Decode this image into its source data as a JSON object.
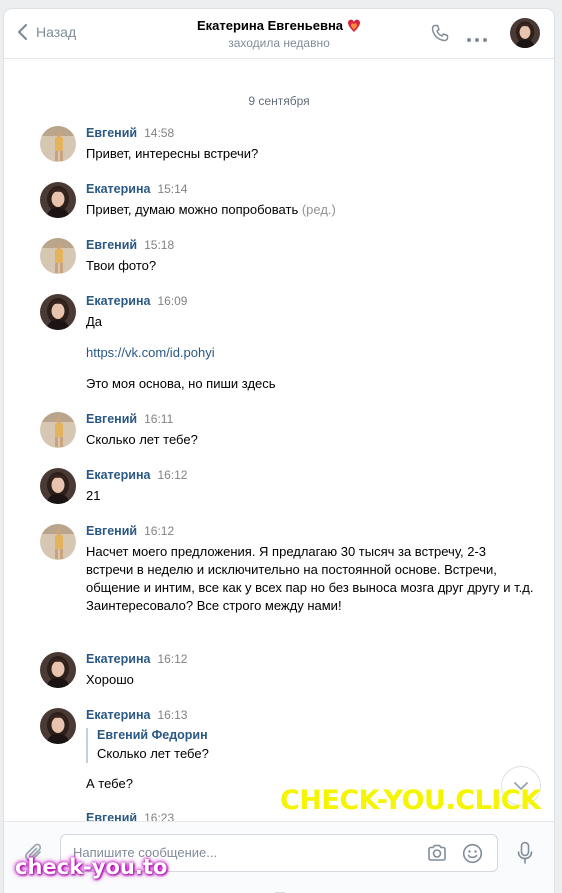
{
  "header": {
    "back_label": "Назад",
    "title": "Екатерина Евгеньевна",
    "title_emoji": "❤️‍🔥",
    "subtitle": "заходила недавно"
  },
  "date_separator": "9 сентября",
  "messages": [
    {
      "author": "Евгений",
      "time": "14:58",
      "text": "Привет, интересны встречи?"
    },
    {
      "author": "Екатерина",
      "time": "15:14",
      "text": "Привет, думаю можно попробовать",
      "edited": "(ред.)"
    },
    {
      "author": "Евгений",
      "time": "15:18",
      "text": "Твои фото?"
    },
    {
      "author": "Екатерина",
      "time": "16:09",
      "lines": [
        "Да",
        "https://vk.com/id.pohyi",
        "Это моя основа, но пиши здесь"
      ]
    },
    {
      "author": "Евгений",
      "time": "16:11",
      "text": "Сколько лет тебе?"
    },
    {
      "author": "Екатерина",
      "time": "16:12",
      "text": "21"
    },
    {
      "author": "Евгений",
      "time": "16:12",
      "text": "Насчет моего предложения. Я предлагаю 30 тысяч за встречу, 2-3 встречи в неделю и исключительно на постоянной основе. Встречи, общение и интим, все как у всех пар но без выноса мозга друг другу и т.д. Заинтересовало? Все строго между нами!"
    },
    {
      "author": "Екатерина",
      "time": "16:12",
      "text": "Хорошо"
    },
    {
      "author": "Екатерина",
      "time": "16:13",
      "quote_author": "Евгений Федорин",
      "quote_text": "Сколько лет тебе?",
      "text": "А тебе?"
    },
    {
      "author": "Евгений",
      "time": "16:23"
    }
  ],
  "composer": {
    "placeholder": "Напишите сообщение..."
  },
  "watermarks": {
    "big": "CHECK-YOU.CLICK",
    "small": "check-you.to"
  },
  "colors": {
    "accent": "#2a5885",
    "icon": "#818c99",
    "watermark_yellow": "#f5f500"
  }
}
